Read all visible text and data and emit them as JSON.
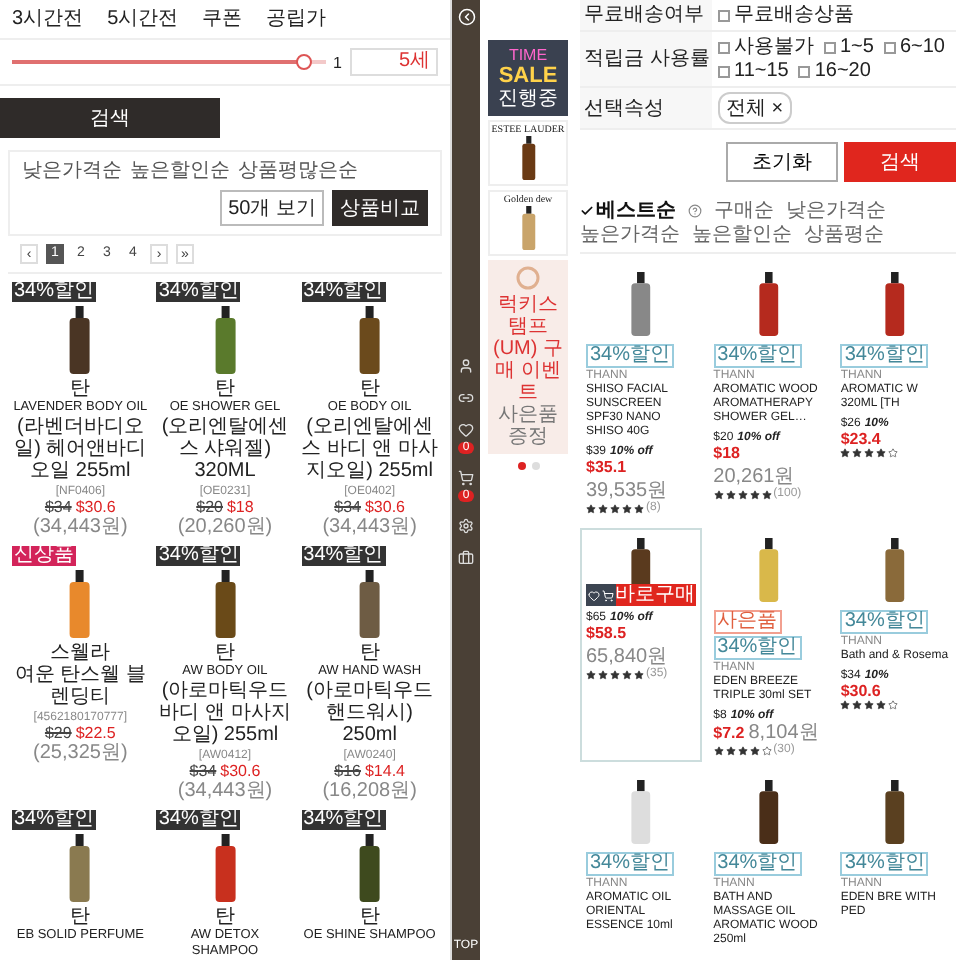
{
  "left_page": {
    "period_tabs": [
      "3시간전",
      "5시간전",
      "쿠폰",
      "공립가"
    ],
    "price_slider": {
      "level": 0.93,
      "label": "1",
      "value": "5세"
    },
    "search_button": "검색",
    "sort_options": [
      {
        "label": "낮은가격순",
        "selected": false
      },
      {
        "label": "높은할인순",
        "selected": false
      },
      {
        "label": "상품평많은순",
        "selected": false
      }
    ],
    "per_page_select": "50개 보기",
    "compare_button": "상품비교",
    "pagination": {
      "prev": "‹",
      "pages": [
        {
          "label": "1",
          "selected": true
        },
        {
          "label": "2",
          "selected": false
        },
        {
          "label": "3",
          "selected": false
        },
        {
          "label": "4",
          "selected": false
        }
      ],
      "next": "›",
      "last": "»"
    },
    "products": [
      {
        "badge": {
          "text": "34%할인",
          "kind": "discount"
        },
        "brand": "탄",
        "name": "LAVENDER BODY OIL",
        "name_ko": "(라벤더바디오일) 헤어앤바디오일 255ml",
        "code": "[NF0406]",
        "list_price": "$34",
        "sale_price": "$30.6",
        "won": "(34,443원)"
      },
      {
        "badge": {
          "text": "34%할인",
          "kind": "discount"
        },
        "brand": "탄",
        "name": "OE SHOWER GEL",
        "name_ko": "(오리엔탈에센스 샤워젤) 320ML",
        "code": "[OE0231]",
        "list_price": "$20",
        "sale_price": "$18",
        "won": "(20,260원)"
      },
      {
        "badge": {
          "text": "34%할인",
          "kind": "discount"
        },
        "brand": "탄",
        "name": "OE BODY OIL",
        "name_ko": "(오리엔탈에센스 바디 앤 마사지오일) 255ml",
        "code": "[OE0402]",
        "list_price": "$34",
        "sale_price": "$30.6",
        "won": "(34,443원)"
      },
      {
        "badge": {
          "text": "신상품",
          "kind": "new"
        },
        "brand": "스웰라",
        "name_ko": "여운 탄스웰 블렌딩티",
        "code": "[4562180170777]",
        "list_price": "$29",
        "sale_price": "$22.5",
        "won": "(25,325원)"
      },
      {
        "badge": {
          "text": "34%할인",
          "kind": "discount"
        },
        "brand": "탄",
        "name": "AW BODY OIL",
        "name_ko": "(아로마틱우드 바디 앤 마사지오일) 255ml",
        "code": "[AW0412]",
        "list_price": "$34",
        "sale_price": "$30.6",
        "won": "(34,443원)"
      },
      {
        "badge": {
          "text": "34%할인",
          "kind": "discount"
        },
        "brand": "탄",
        "name": "AW HAND WASH",
        "name_ko": "(아로마틱우드 핸드워시) 250ml",
        "code": "[AW0240]",
        "list_price": "$16",
        "sale_price": "$14.4",
        "won": "(16,208원)"
      },
      {
        "badge": {
          "text": "34%할인",
          "kind": "discount"
        },
        "brand": "탄",
        "name": "EB SOLID PERFUME"
      },
      {
        "badge": {
          "text": "34%할인",
          "kind": "discount"
        },
        "brand": "탄",
        "name": "AW DETOX SHAMPOO"
      },
      {
        "badge": {
          "text": "34%할인",
          "kind": "discount"
        },
        "brand": "탄",
        "name": "OE SHINE SHAMPOO"
      }
    ]
  },
  "quick_bar": {
    "wish_count": "0",
    "cart_count": "0",
    "top": "TOP"
  },
  "banners": [
    {
      "kind": "timesale",
      "title": "TIME",
      "headline": "SALE",
      "caption": "진행중"
    },
    {
      "kind": "brand",
      "title": "ESTEE LAUDER"
    },
    {
      "kind": "brand",
      "title": "Golden dew"
    },
    {
      "kind": "event",
      "title": "럭키스탬프(UM) 구매 이벤트",
      "caption": "사은품 증정"
    }
  ],
  "banner_dots": [
    {
      "selected": true
    },
    {
      "selected": false
    }
  ],
  "filter": {
    "rows": [
      {
        "label": "무료배송여부",
        "options": [
          {
            "label": "무료배송상품",
            "checked": false
          }
        ]
      },
      {
        "label": "적립금 사용률",
        "options": [
          {
            "label": "사용불가",
            "checked": false
          },
          {
            "label": "1~5",
            "checked": false
          },
          {
            "label": "6~10",
            "checked": false
          },
          {
            "label": "11~15",
            "checked": false
          },
          {
            "label": "16~20",
            "checked": false
          }
        ]
      },
      {
        "label": "선택속성",
        "chip": "전체 ×"
      }
    ],
    "reset_button": "초기화",
    "search_button": "검색"
  },
  "sort_tabs": [
    {
      "label": "베스트순",
      "selected": true,
      "help": true
    },
    {
      "label": "구매순",
      "selected": false,
      "help": false
    },
    {
      "label": "낮은가격순",
      "selected": false,
      "help": false
    },
    {
      "label": "높은가격순",
      "selected": false,
      "help": false
    },
    {
      "label": "높은할인순",
      "selected": false,
      "help": false
    },
    {
      "label": "상품평순",
      "selected": false,
      "help": false
    }
  ],
  "products": [
    {
      "hovered": false,
      "tags": [
        {
          "text": "34%할인",
          "kind": "discount"
        }
      ],
      "brand": "THANN",
      "name": "SHISO FACIAL SUNSCREEN SPF30 NANO SHISO 40G",
      "list_price": "$39",
      "discount": "10% off",
      "sale_price": "$35.1",
      "won": "39,535원",
      "stars": 5,
      "reviews": "(8)"
    },
    {
      "hovered": false,
      "tags": [
        {
          "text": "34%할인",
          "kind": "discount"
        }
      ],
      "brand": "THANN",
      "name": "AROMATIC WOOD AROMATHERAPY SHOWER GEL…",
      "list_price": "$20",
      "discount": "10% off",
      "sale_price": "$18",
      "won": "20,261원",
      "stars": 5,
      "reviews": "(100)"
    },
    {
      "hovered": false,
      "tags": [
        {
          "text": "34%할인",
          "kind": "discount"
        }
      ],
      "brand": "THANN",
      "name": "AROMATIC W 320ML [TH",
      "list_price": "$26",
      "discount": "10%",
      "sale_price": "$23.4",
      "stars": 4
    },
    {
      "hovered": true,
      "buy_label": "바로구매",
      "list_price": "$65",
      "discount": "10% off",
      "sale_price": "$58.5",
      "won": "65,840원",
      "stars": 5,
      "reviews": "(35)"
    },
    {
      "hovered": false,
      "tags": [
        {
          "text": "사은품",
          "kind": "gift"
        },
        {
          "text": "34%할인",
          "kind": "discount"
        }
      ],
      "brand": "THANN",
      "name": "EDEN BREEZE TRIPLE 30ml SET",
      "list_price": "$8",
      "discount": "10% off",
      "sale_price": "$7.2",
      "won": "8,104원",
      "stars": 4,
      "reviews": "(30)"
    },
    {
      "hovered": false,
      "tags": [
        {
          "text": "34%할인",
          "kind": "discount"
        }
      ],
      "brand": "THANN",
      "name": "Bath and & Rosema",
      "list_price": "$34",
      "discount": "10%",
      "sale_price": "$30.6",
      "stars": 4
    },
    {
      "hovered": false,
      "tags": [
        {
          "text": "34%할인",
          "kind": "discount"
        }
      ],
      "brand": "THANN",
      "name": "AROMATIC OIL ORIENTAL ESSENCE 10ml"
    },
    {
      "hovered": false,
      "tags": [
        {
          "text": "34%할인",
          "kind": "discount"
        }
      ],
      "brand": "THANN",
      "name": "BATH AND MASSAGE OIL AROMATIC WOOD 250ml"
    },
    {
      "hovered": false,
      "tags": [
        {
          "text": "34%할인",
          "kind": "discount"
        }
      ],
      "brand": "THANN",
      "name": "EDEN BRE WITH PED"
    }
  ]
}
